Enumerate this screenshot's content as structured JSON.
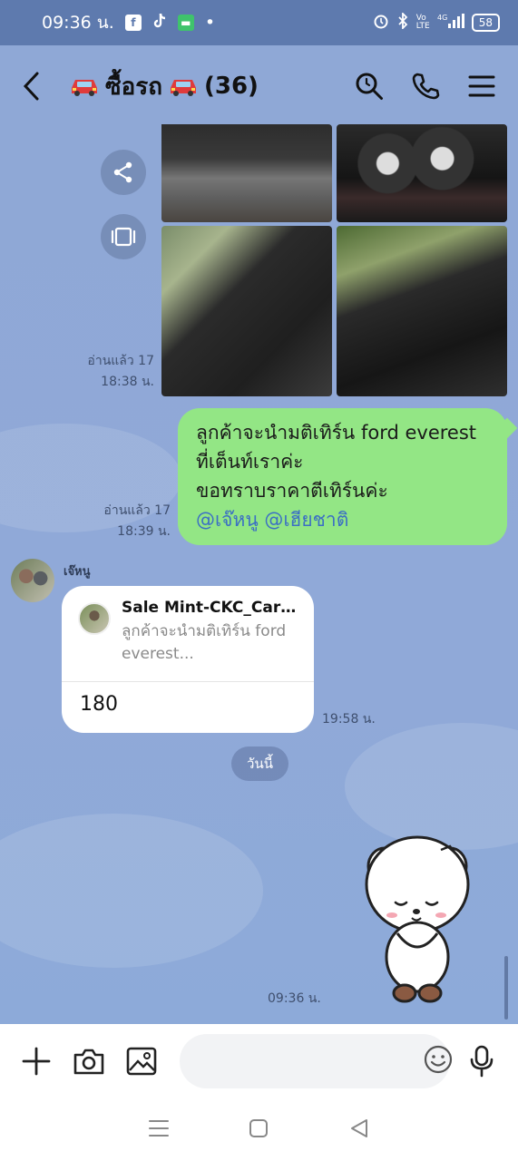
{
  "status_bar": {
    "time": "09:36 น.",
    "icons": [
      "facebook-icon",
      "tiktok-icon",
      "chat-app-icon",
      "dot-icon"
    ],
    "right_icons": [
      "alarm-icon",
      "bluetooth-icon",
      "volte-icon",
      "signal-4g-icon"
    ],
    "battery": "58"
  },
  "header": {
    "title_text": "ซื้อรถ",
    "member_count": "(36)",
    "icons": [
      "back-icon",
      "search-icon",
      "call-icon",
      "menu-icon"
    ]
  },
  "messages": {
    "photo_read": "อ่านแล้ว 17",
    "photo_time": "18:38 น.",
    "outgoing": {
      "line1": "ลูกค้าจะนำมติเทิร์น ford everest",
      "line2": "ที่เต็นท์เราค่ะ",
      "line3": "ขอทราบราคาตีเทิร์นค่ะ",
      "mention1": "@เจ๊หนู",
      "mention2": "@เฮียชาติ",
      "read": "อ่านแล้ว 17",
      "time": "18:39 น."
    },
    "incoming": {
      "sender": "เจ๊หนู",
      "reply_name": "Sale Mint-CKC_Car2...",
      "reply_snippet": "ลูกค้าจะนำมติเทิร์น ford everest...",
      "text": "180",
      "time": "19:58 น."
    },
    "day_divider": "วันนี้",
    "sticker_time": "09:36 น."
  },
  "input_bar": {
    "placeholder": "",
    "icons": [
      "plus-icon",
      "camera-icon",
      "gallery-icon",
      "emoji-icon",
      "mic-icon"
    ]
  },
  "nav_bar": {
    "icons": [
      "recent-apps-icon",
      "home-icon",
      "back-nav-icon"
    ]
  },
  "colors": {
    "chat_bg": "#8FA8D6",
    "status_bg": "#5E7AAE",
    "outgoing_bubble": "#93E685",
    "mention": "#3B6FC4"
  }
}
